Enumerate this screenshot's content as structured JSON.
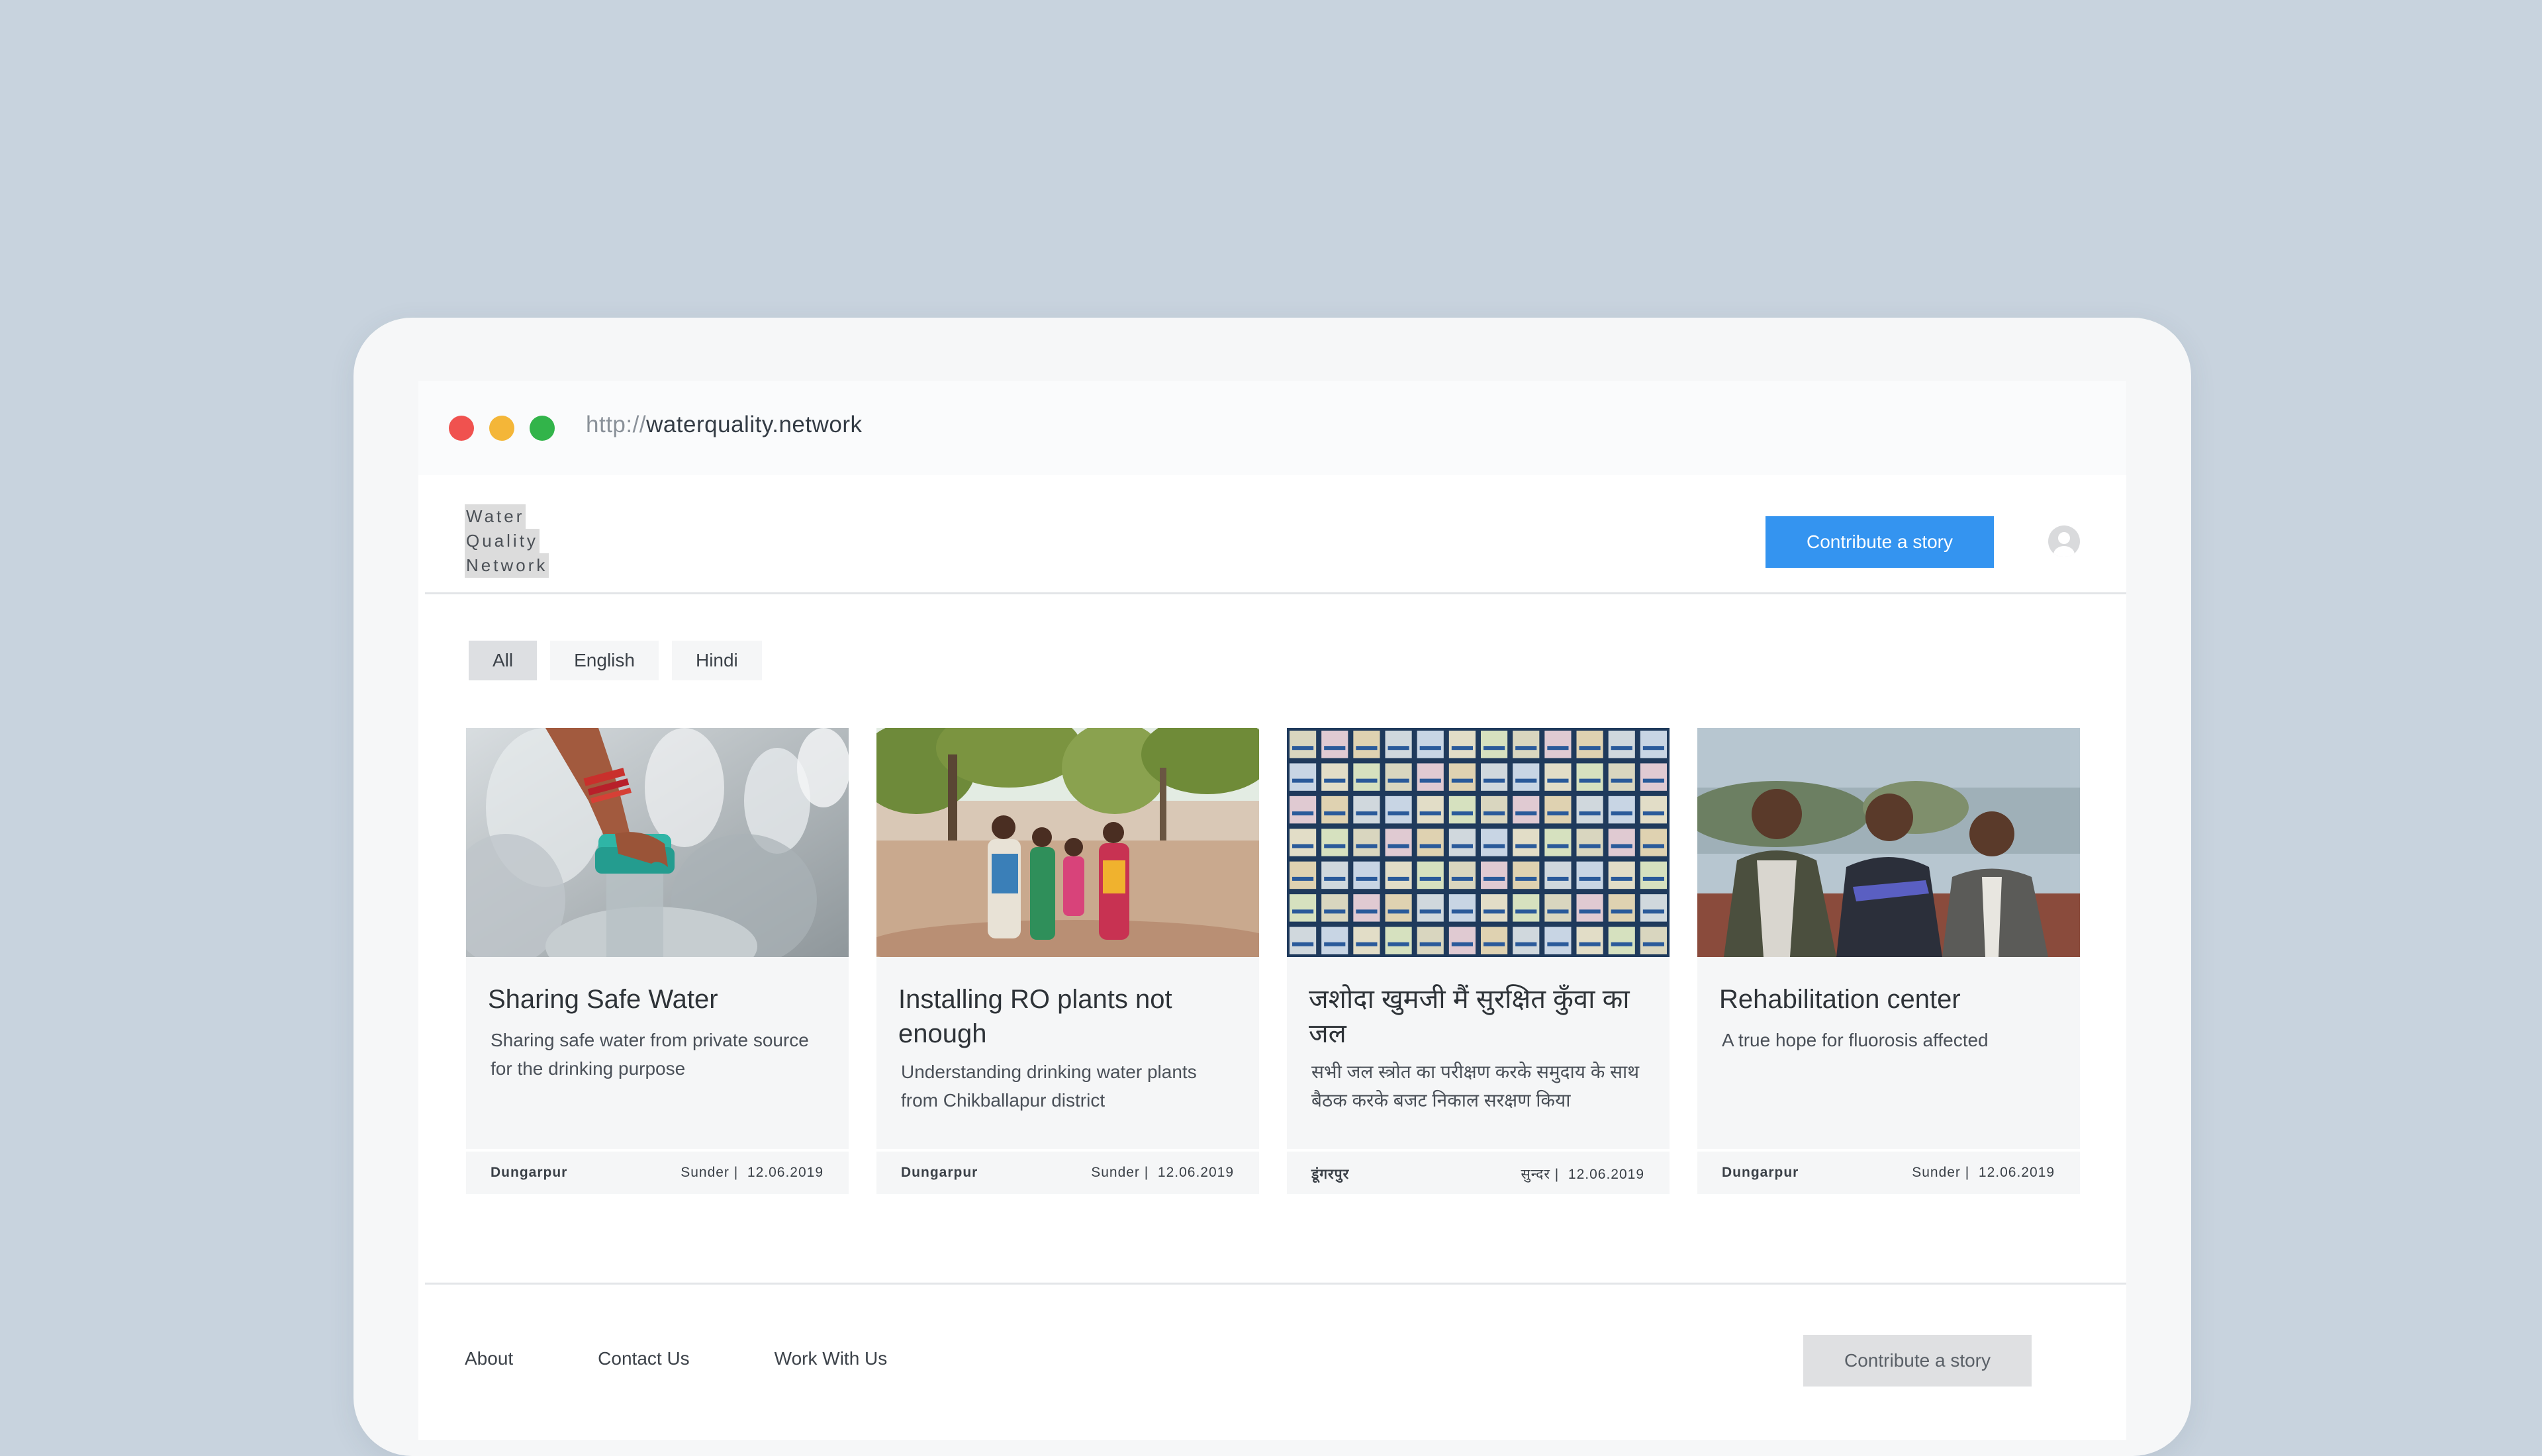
{
  "colors": {
    "background": "#c8d3de",
    "accent": "#3494f0",
    "traffic_red": "#f0524f",
    "traffic_yellow": "#f4b638",
    "traffic_green": "#32b44a"
  },
  "browser": {
    "url_protocol": "http://",
    "url_host": "waterquality.network"
  },
  "header": {
    "logo_lines": [
      "Water",
      "Quality",
      "Network"
    ],
    "cta_label": "Contribute a story",
    "avatar_icon": "user-avatar-icon"
  },
  "filters": [
    {
      "label": "All",
      "active": true
    },
    {
      "label": "English",
      "active": false
    },
    {
      "label": "Hindi",
      "active": false
    }
  ],
  "cards": [
    {
      "title": "Sharing Safe Water",
      "description": "Sharing safe water from private source for the drinking purpose",
      "location": "Dungarpur",
      "author": "Sunder |",
      "date": "12.06.2019"
    },
    {
      "title": "Installing RO plants not enough",
      "description": "Understanding drinking water plants from Chikballapur district",
      "location": "Dungarpur",
      "author": "Sunder |",
      "date": "12.06.2019"
    },
    {
      "title": "जशोदा खुमजी मैं सुरक्षित कुँवा का जल",
      "description": "सभी जल स्त्रोत का परीक्षण करके समुदाय के साथ बैठक करके बजट निकाल सरक्षण किया",
      "location": "डूंगरपुर",
      "author": "सुन्दर |",
      "date": "12.06.2019"
    },
    {
      "title": "Rehabilitation center",
      "description": "A true hope for fluorosis affected",
      "location": "Dungarpur",
      "author": "Sunder |",
      "date": "12.06.2019"
    }
  ],
  "footer": {
    "links": [
      "About",
      "Contact Us",
      "Work With Us"
    ],
    "cta_label": "Contribute a story"
  }
}
